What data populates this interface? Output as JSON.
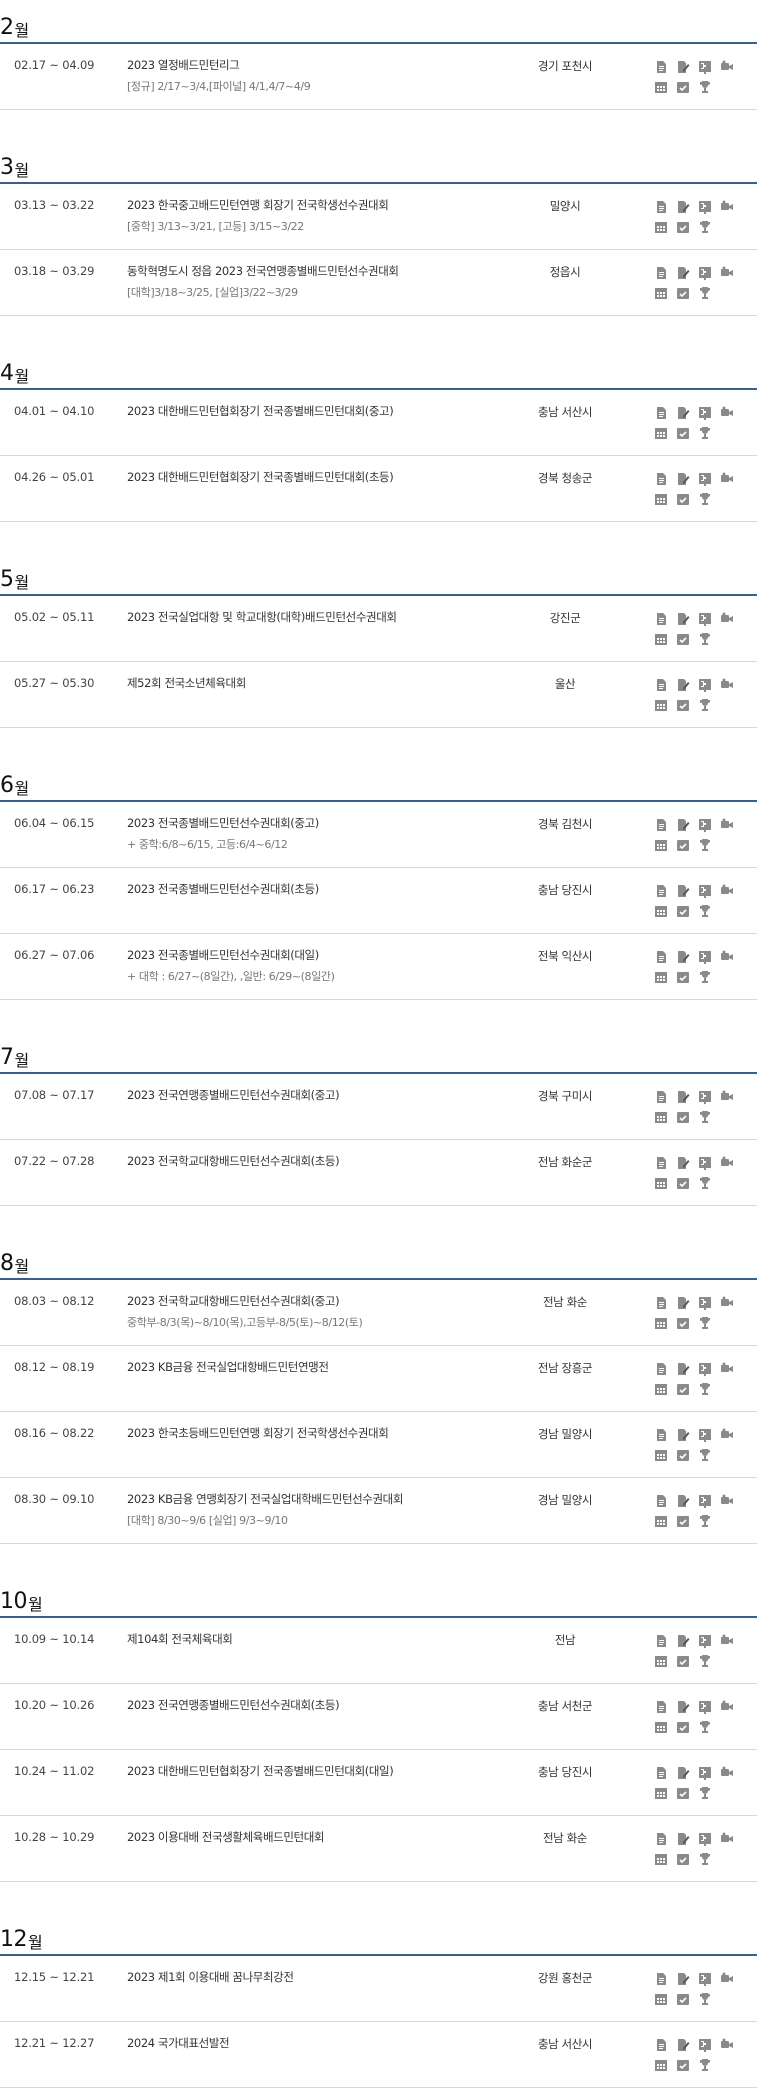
{
  "months": [
    {
      "num": "2",
      "suffix": "월",
      "events": [
        {
          "period": "02.17 ~ 04.09",
          "name": "2023 열정배드민턴리그",
          "sub": "[정규] 2/17~3/4,[파이널] 4/1,4/7~4/9",
          "location": "경기 포천시"
        }
      ]
    },
    {
      "num": "3",
      "suffix": "월",
      "events": [
        {
          "period": "03.13 ~ 03.22",
          "name": "2023 한국중고배드민턴연맹 회장기 전국학생선수권대회",
          "sub": "[중학] 3/13~3/21, [고등] 3/15~3/22",
          "location": "밀양시"
        },
        {
          "period": "03.18 ~ 03.29",
          "name": "동학혁명도시 정읍 2023 전국연맹종별배드민턴선수권대회",
          "sub": "[대학]3/18~3/25, [실업]3/22~3/29",
          "location": "정읍시"
        }
      ]
    },
    {
      "num": "4",
      "suffix": "월",
      "events": [
        {
          "period": "04.01 ~ 04.10",
          "name": "2023 대한배드민턴협회장기 전국종별배드민턴대회(중고)",
          "sub": "",
          "location": "충남 서산시"
        },
        {
          "period": "04.26 ~ 05.01",
          "name": "2023 대한배드민턴협회장기 전국종별배드민턴대회(초등)",
          "sub": "",
          "location": "경북 청송군"
        }
      ]
    },
    {
      "num": "5",
      "suffix": "월",
      "events": [
        {
          "period": "05.02 ~ 05.11",
          "name": "2023 전국실업대항 및 학교대항(대학)배드민턴선수권대회",
          "sub": "",
          "location": "강진군"
        },
        {
          "period": "05.27 ~ 05.30",
          "name": "제52회 전국소년체육대회",
          "sub": "",
          "location": "울산"
        }
      ]
    },
    {
      "num": "6",
      "suffix": "월",
      "events": [
        {
          "period": "06.04 ~ 06.15",
          "name": "2023 전국종별배드민턴선수권대회(중고)",
          "sub": "+ 중학:6/8~6/15, 고등:6/4~6/12",
          "location": "경북 김천시"
        },
        {
          "period": "06.17 ~ 06.23",
          "name": "2023 전국종별배드민턴선수권대회(초등)",
          "sub": "",
          "location": "충남 당진시"
        },
        {
          "period": "06.27 ~ 07.06",
          "name": "2023 전국종별배드민턴선수권대회(대일)",
          "sub": "+ 대학 : 6/27~(8일간), ,일반: 6/29~(8일간)",
          "location": "전북 익산시"
        }
      ]
    },
    {
      "num": "7",
      "suffix": "월",
      "events": [
        {
          "period": "07.08 ~ 07.17",
          "name": "2023 전국연맹종별배드민턴선수권대회(중고)",
          "sub": "",
          "location": "경북 구미시"
        },
        {
          "period": "07.22 ~ 07.28",
          "name": "2023 전국학교대항배드민턴선수권대회(초등)",
          "sub": "",
          "location": "전남 화순군"
        }
      ]
    },
    {
      "num": "8",
      "suffix": "월",
      "events": [
        {
          "period": "08.03 ~ 08.12",
          "name": "2023 전국학교대항배드민턴선수권대회(중고)",
          "sub": "중학부-8/3(목)~8/10(목),고등부-8/5(토)~8/12(토)",
          "location": "전남 화순"
        },
        {
          "period": "08.12 ~ 08.19",
          "name": "2023 KB금융 전국실업대항배드민턴연맹전",
          "sub": "",
          "location": "전남 장흥군"
        },
        {
          "period": "08.16 ~ 08.22",
          "name": "2023 한국초등배드민턴연맹 회장기 전국학생선수권대회",
          "sub": "",
          "location": "경남 밀양시"
        },
        {
          "period": "08.30 ~ 09.10",
          "name": "2023 KB금융 연맹회장기 전국실업대학배드민턴선수권대회",
          "sub": "[대학] 8/30~9/6 [실업] 9/3~9/10",
          "location": "경남 밀양시"
        }
      ]
    },
    {
      "num": "10",
      "suffix": "월",
      "events": [
        {
          "period": "10.09 ~ 10.14",
          "name": "제104회 전국체육대회",
          "sub": "",
          "location": "전남"
        },
        {
          "period": "10.20 ~ 10.26",
          "name": "2023 전국연맹종별배드민턴선수권대회(초등)",
          "sub": "",
          "location": "충남 서천군"
        },
        {
          "period": "10.24 ~ 11.02",
          "name": "2023 대한배드민턴협회장기 전국종별배드민턴대회(대일)",
          "sub": "",
          "location": "충남 당진시"
        },
        {
          "period": "10.28 ~ 10.29",
          "name": "2023 이용대배 전국생활체육배드민턴대회",
          "sub": "",
          "location": "전남 화순"
        }
      ]
    },
    {
      "num": "12",
      "suffix": "월",
      "events": [
        {
          "period": "12.15 ~ 12.21",
          "name": "2023 제1회 이용대배 꿈나무최강전",
          "sub": "",
          "location": "강원 홍천군"
        },
        {
          "period": "12.21 ~ 12.27",
          "name": "2024 국가대표선발전",
          "sub": "",
          "location": "충남 서산시"
        }
      ]
    }
  ],
  "icons": [
    "document-icon",
    "edit-icon",
    "bracket-icon",
    "video-icon",
    "calendar-icon",
    "check-calendar-icon",
    "trophy-icon"
  ],
  "colors": {
    "accent_line": "#3c5f88",
    "icon": "#8a8a8a"
  }
}
